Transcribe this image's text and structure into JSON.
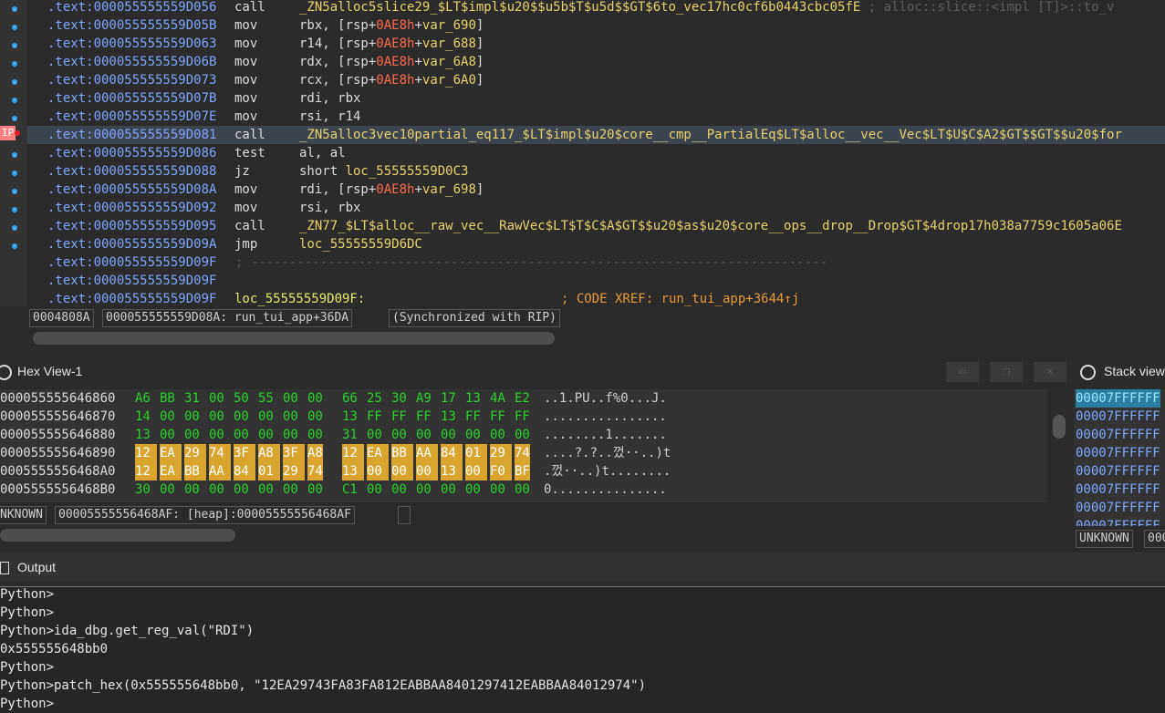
{
  "disasm": {
    "lines": [
      {
        "addr": ".text:000055555559D056",
        "mn": "call",
        "op": [
          {
            "t": "_ZN5alloc5slice29_$LT$impl$u20$$u5b$T$u5d$$GT$6to_vec17hc0cf6b0443cbc05fE",
            "c": "sym"
          },
          {
            "t": " ; alloc::slice::<impl [T]>::to_v",
            "c": "dim"
          }
        ]
      },
      {
        "addr": ".text:000055555559D05B",
        "mn": "mov",
        "op": [
          {
            "t": "rbx, [rsp+",
            "c": ""
          },
          {
            "t": "0AE8h",
            "c": "imm"
          },
          {
            "t": "+",
            "c": ""
          },
          {
            "t": "var_690",
            "c": "var"
          },
          {
            "t": "]",
            "c": ""
          }
        ]
      },
      {
        "addr": ".text:000055555559D063",
        "mn": "mov",
        "op": [
          {
            "t": "r14, [rsp+",
            "c": ""
          },
          {
            "t": "0AE8h",
            "c": "imm"
          },
          {
            "t": "+",
            "c": ""
          },
          {
            "t": "var_688",
            "c": "var"
          },
          {
            "t": "]",
            "c": ""
          }
        ]
      },
      {
        "addr": ".text:000055555559D06B",
        "mn": "mov",
        "op": [
          {
            "t": "rdx, [rsp+",
            "c": ""
          },
          {
            "t": "0AE8h",
            "c": "imm"
          },
          {
            "t": "+",
            "c": ""
          },
          {
            "t": "var_6A8",
            "c": "var"
          },
          {
            "t": "]",
            "c": ""
          }
        ]
      },
      {
        "addr": ".text:000055555559D073",
        "mn": "mov",
        "op": [
          {
            "t": "rcx, [rsp+",
            "c": ""
          },
          {
            "t": "0AE8h",
            "c": "imm"
          },
          {
            "t": "+",
            "c": ""
          },
          {
            "t": "var_6A0",
            "c": "var"
          },
          {
            "t": "]",
            "c": ""
          }
        ]
      },
      {
        "addr": ".text:000055555559D07B",
        "mn": "mov",
        "op": [
          {
            "t": "rdi, rbx",
            "c": ""
          }
        ]
      },
      {
        "addr": ".text:000055555559D07E",
        "mn": "mov",
        "op": [
          {
            "t": "rsi, r14",
            "c": ""
          }
        ]
      },
      {
        "addr": ".text:000055555559D081",
        "mn": "call",
        "op": [
          {
            "t": "_ZN5alloc3vec10partial_eq117_$LT$impl$u20$core__cmp__PartialEq$LT$alloc__vec__Vec$LT$U$C$A2$GT$$GT$$u20$for",
            "c": "sym"
          }
        ]
      },
      {
        "addr": ".text:000055555559D086",
        "mn": "test",
        "op": [
          {
            "t": "al, al",
            "c": ""
          }
        ]
      },
      {
        "addr": ".text:000055555559D088",
        "mn": "jz",
        "op": [
          {
            "t": "short ",
            "c": ""
          },
          {
            "t": "loc_55555559D0C3",
            "c": "sym"
          }
        ]
      },
      {
        "addr": ".text:000055555559D08A",
        "mn": "mov",
        "op": [
          {
            "t": "rdi, [rsp+",
            "c": ""
          },
          {
            "t": "0AE8h",
            "c": "imm"
          },
          {
            "t": "+",
            "c": ""
          },
          {
            "t": "var_698",
            "c": "var"
          },
          {
            "t": "]",
            "c": ""
          }
        ]
      },
      {
        "addr": ".text:000055555559D092",
        "mn": "mov",
        "op": [
          {
            "t": "rsi, rbx",
            "c": ""
          }
        ]
      },
      {
        "addr": ".text:000055555559D095",
        "mn": "call",
        "op": [
          {
            "t": "_ZN77_$LT$alloc__raw_vec__RawVec$LT$T$C$A$GT$$u20$as$u20$core__ops__drop__Drop$GT$4drop17h038a7759c1605a06E",
            "c": "sym"
          }
        ]
      },
      {
        "addr": ".text:000055555559D09A",
        "mn": "jmp",
        "op": [
          {
            "t": "loc_55555559D6DC",
            "c": "sym"
          }
        ]
      },
      {
        "addr": ".text:000055555559D09F",
        "mn": "",
        "sep": "; ---------------------------------------------------------------------------",
        "op": []
      },
      {
        "addr": ".text:000055555559D09F",
        "mn": "",
        "op": []
      },
      {
        "addr": ".text:000055555559D09F",
        "mn": "",
        "label": "loc_55555559D09F:",
        "comment": "; CODE XREF: run_tui_app+3644↑j",
        "op": []
      }
    ],
    "gutter": {
      "ip_label": "IP"
    },
    "status": [
      "0004808A",
      "000055555559D08A: run_tui_app+36DA",
      "(Synchronized with RIP)"
    ]
  },
  "hex": {
    "title": "Hex View-1",
    "rows": [
      {
        "addr": "000055555646860",
        "bytes": [
          "A6",
          "BB",
          "31",
          "00",
          "50",
          "55",
          "00",
          "00",
          "66",
          "25",
          "30",
          "A9",
          "17",
          "13",
          "4A",
          "E2"
        ],
        "ascii": "..1.PU..f%0...J."
      },
      {
        "addr": "000055555646870",
        "bytes": [
          "14",
          "00",
          "00",
          "00",
          "00",
          "00",
          "00",
          "00",
          "13",
          "FF",
          "FF",
          "FF",
          "13",
          "FF",
          "FF",
          "FF"
        ],
        "ascii": "................"
      },
      {
        "addr": "000055555646880",
        "bytes": [
          "13",
          "00",
          "00",
          "00",
          "00",
          "00",
          "00",
          "00",
          "31",
          "00",
          "00",
          "00",
          "00",
          "00",
          "00",
          "00"
        ],
        "ascii": "........1......."
      },
      {
        "addr": "000055555646890",
        "bytes": [
          "12",
          "EA",
          "29",
          "74",
          "3F",
          "A8",
          "3F",
          "A8",
          "12",
          "EA",
          "BB",
          "AA",
          "84",
          "01",
          "29",
          "74"
        ],
        "ascii": "....?.?..껐··..)t"
      },
      {
        "addr": "0005555556468A0",
        "bytes": [
          "12",
          "EA",
          "BB",
          "AA",
          "84",
          "01",
          "29",
          "74",
          "13",
          "00",
          "00",
          "00",
          "13",
          "00",
          "F0",
          "BF"
        ],
        "ascii": ".껐··..)t........"
      },
      {
        "addr": "0005555556468B0",
        "bytes": [
          "30",
          "00",
          "00",
          "00",
          "00",
          "00",
          "00",
          "00",
          "C1",
          "00",
          "00",
          "00",
          "00",
          "00",
          "00",
          "00"
        ],
        "ascii": "0..............."
      }
    ],
    "selected_rows": [
      3,
      4
    ],
    "status": [
      "NKNOWN",
      "00005555556468AF: [heap]:00005555556468AF"
    ]
  },
  "stack": {
    "title": "Stack view",
    "rows": [
      "00007FFFFFF",
      "00007FFFFFF",
      "00007FFFFFF",
      "00007FFFFFF",
      "00007FFFFFF",
      "00007FFFFFF",
      "00007FFFFFF",
      "00007FFFFFF"
    ],
    "selected_index": 0,
    "status": [
      "UNKNOWN",
      "000"
    ]
  },
  "output": {
    "title": "Output",
    "lines": [
      "Python>",
      "Python>",
      "Python>ida_dbg.get_reg_val(\"RDI\")",
      "0x555555648bb0",
      "Python>",
      "Python>patch_hex(0x555555648bb0, \"12EA29743FA83FA812EABBAA8401297412EABBAA84012974\")",
      "Python>"
    ]
  }
}
